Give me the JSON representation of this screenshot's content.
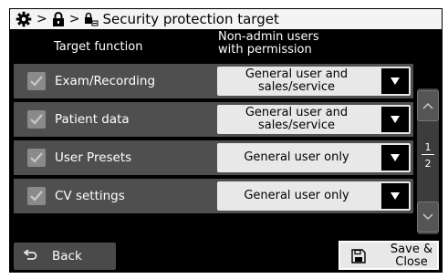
{
  "title_bar": {
    "title": "Security protection target"
  },
  "table": {
    "col_target_function": "Target function",
    "col_permission_line1": "Non-admin users",
    "col_permission_line2": "with permission"
  },
  "rows": [
    {
      "label": "Exam/Recording",
      "checked": true,
      "value_line1": "General user and",
      "value_line2": "sales/service"
    },
    {
      "label": "Patient data",
      "checked": true,
      "value_line1": "General user and",
      "value_line2": "sales/service"
    },
    {
      "label": "User Presets",
      "checked": true,
      "value_line1": "General user only",
      "value_line2": ""
    },
    {
      "label": "CV settings",
      "checked": true,
      "value_line1": "General user only",
      "value_line2": ""
    }
  ],
  "pagination": {
    "current": "1",
    "total": "2"
  },
  "footer": {
    "back_label": "Back",
    "save_line1": "Save &",
    "save_line2": "Close"
  },
  "icons": {
    "settings": "gear-icon",
    "lock": "lock-icon",
    "security_target": "lock-target-icon",
    "back": "return-arrow-icon",
    "save": "floppy-disk-icon"
  },
  "colors": {
    "background": "#000000",
    "row": "#4f4f4f",
    "dropdown": "#e8e8e8",
    "titlebar": "#f4f4f4",
    "checkbox": "#8a8a8a"
  }
}
